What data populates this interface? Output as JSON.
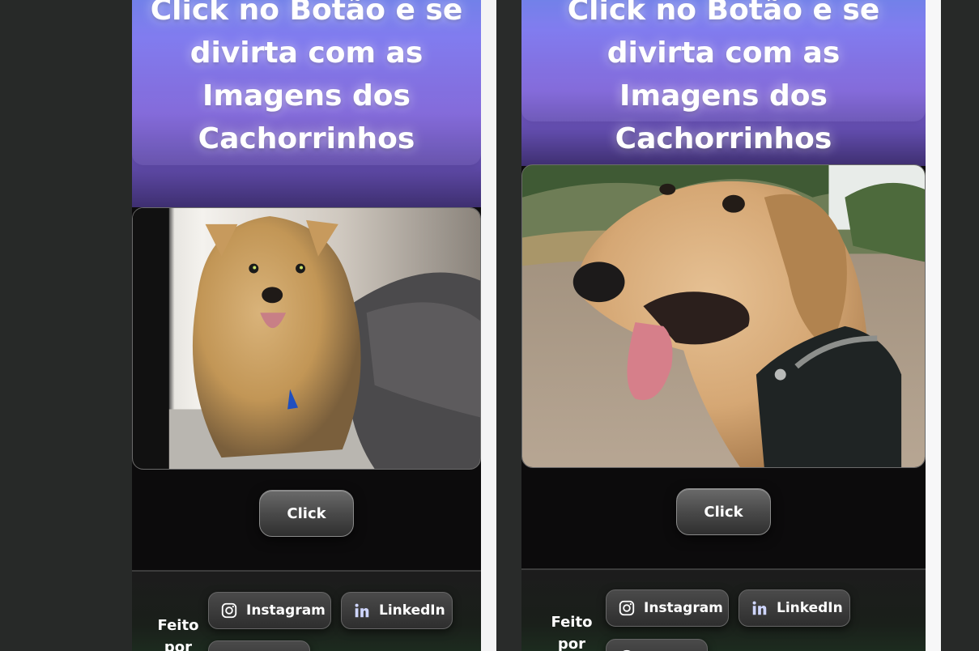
{
  "panels": [
    {
      "title": "Click no Botão e se divirta com as Imagens dos Cachorrinhos",
      "image_subject": "yorkshire-terrier-photo",
      "button_label": "Click",
      "footer": {
        "made_by": "Feito por",
        "instagram": "Instagram",
        "linkedin": "LinkedIn"
      }
    },
    {
      "title": "Click no Botão e se divirta com as Imagens dos Cachorrinhos",
      "image_subject": "hound-dog-photo",
      "button_label": "Click",
      "footer": {
        "made_by": "Feito por",
        "instagram": "Instagram",
        "linkedin": "LinkedIn"
      }
    }
  ],
  "icons": {
    "instagram": "instagram-icon",
    "linkedin": "linkedin-icon",
    "github": "github-icon"
  },
  "colors": {
    "hero_top": "#6a7ae8",
    "hero_bottom": "#3e2f70",
    "page_bg": "#272928",
    "panel_bg": "#0c0b0c"
  }
}
